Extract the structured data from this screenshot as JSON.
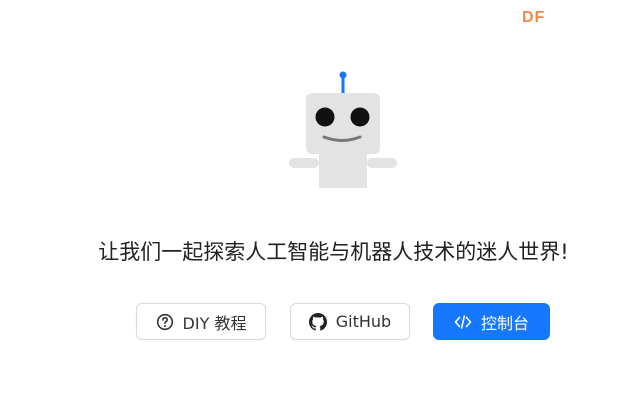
{
  "watermark": {
    "text": "DF"
  },
  "hero": {
    "illustration": "robot-mascot",
    "tagline": "让我们一起探索人工智能与机器人技术的迷人世界!"
  },
  "actions": {
    "diy": {
      "label": "DIY 教程",
      "icon": "question-circle-icon"
    },
    "github": {
      "label": "GitHub",
      "icon": "github-icon"
    },
    "console": {
      "label": "控制台",
      "icon": "code-icon"
    }
  },
  "colors": {
    "primary": "#1677ff",
    "watermark": "#f08a4b",
    "robot_body": "#e3e3e3",
    "robot_antenna": "#1677ff"
  }
}
